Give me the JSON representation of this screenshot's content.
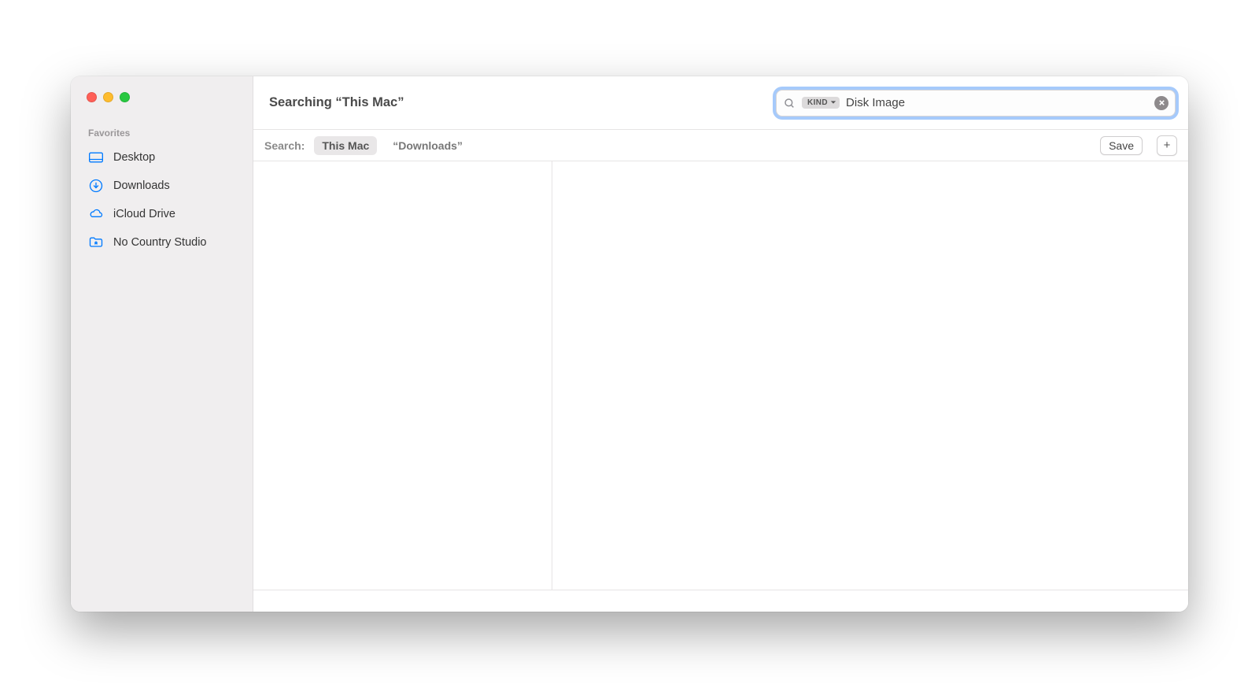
{
  "header": {
    "title": "Searching “This Mac”"
  },
  "search": {
    "token_label": "KIND",
    "value": "Disk Image"
  },
  "scope": {
    "label": "Search:",
    "options": [
      {
        "label": "This Mac",
        "active": true
      },
      {
        "label": "“Downloads”",
        "active": false
      }
    ],
    "save_label": "Save",
    "plus_label": "+"
  },
  "sidebar": {
    "section": "Favorites",
    "items": [
      {
        "label": "Desktop",
        "icon": "desktop"
      },
      {
        "label": "Downloads",
        "icon": "downloads"
      },
      {
        "label": "iCloud Drive",
        "icon": "icloud"
      },
      {
        "label": "No Country Studio",
        "icon": "folder"
      }
    ]
  }
}
